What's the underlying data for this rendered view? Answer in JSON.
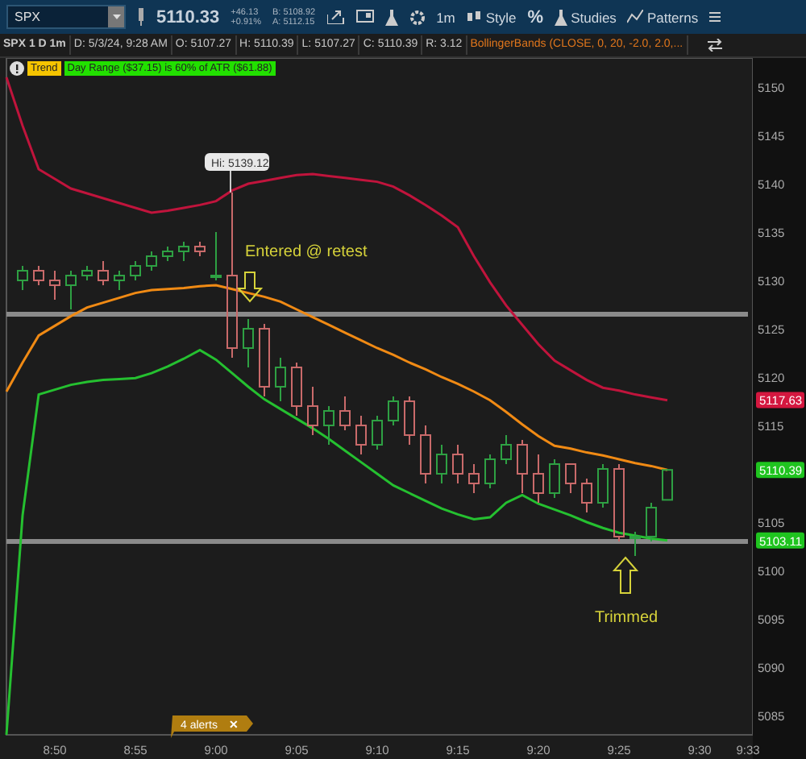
{
  "toolbar": {
    "symbol": "SPX",
    "last": "5110.33",
    "change": "+46.13",
    "change_pct": "+0.91%",
    "bid": "B: 5108.92",
    "ask": "A: 5112.15",
    "interval": "1m",
    "buttons": [
      {
        "kind": "style",
        "label": "Style"
      },
      {
        "kind": "percent",
        "label": "%"
      },
      {
        "kind": "studies",
        "label": "Studies"
      },
      {
        "kind": "patterns",
        "label": "Patterns"
      }
    ]
  },
  "info_bar": [
    "SPX 1 D 1m",
    "D: 5/3/24, 9:28 AM",
    "O: 5107.27",
    "H: 5110.39",
    "L: 5107.27",
    "C: 5110.39",
    "R: 3.12"
  ],
  "study": "BollingerBands (CLOSE, 0, 20, -2.0, 2.0,...",
  "alerts": [
    {
      "label": "Trend",
      "color": "#f5c400"
    },
    {
      "label": "Day Range ($37.15) is 60% of ATR ($61.88)",
      "color": "#22e000"
    }
  ],
  "chart_data": {
    "type": "candlestick",
    "x": [
      527,
      528,
      529,
      530,
      531,
      532,
      533,
      534,
      535,
      536,
      537,
      538,
      539,
      540,
      541,
      542,
      543,
      544,
      545,
      546,
      547,
      548,
      549,
      550,
      551,
      552,
      553,
      554,
      555,
      556,
      557,
      558,
      559,
      560,
      561,
      562,
      563,
      564,
      565,
      566,
      567,
      568,
      569,
      570,
      571,
      572,
      573
    ],
    "xlim": [
      527,
      573.3
    ],
    "ylim": [
      5083,
      5153
    ],
    "xticks": [
      {
        "value": 530,
        "label": "8:50"
      },
      {
        "value": 535,
        "label": "8:55"
      },
      {
        "value": 540,
        "label": "9:00"
      },
      {
        "value": 545,
        "label": "9:05"
      },
      {
        "value": 550,
        "label": "9:10"
      },
      {
        "value": 555,
        "label": "9:15"
      },
      {
        "value": 560,
        "label": "9:20"
      },
      {
        "value": 565,
        "label": "9:25"
      },
      {
        "value": 570,
        "label": "9:30"
      },
      {
        "value": 573,
        "label": "9:33"
      }
    ],
    "yticks": [
      5150,
      5145,
      5140,
      5135,
      5130,
      5125,
      5120,
      5115,
      5105,
      5100,
      5095,
      5090,
      5085
    ],
    "ohlc": [
      null,
      [
        5130,
        5131.5,
        5129,
        5131
      ],
      [
        5131,
        5131.5,
        5129.5,
        5130
      ],
      [
        5130,
        5131,
        5128,
        5129.5
      ],
      [
        5129.5,
        5131,
        5127,
        5130.5
      ],
      [
        5130.5,
        5131.5,
        5130,
        5131
      ],
      [
        5131,
        5132,
        5129.5,
        5130
      ],
      [
        5130,
        5131,
        5129,
        5130.5
      ],
      [
        5130.5,
        5132,
        5130,
        5131.5
      ],
      [
        5131.5,
        5133,
        5131,
        5132.5
      ],
      [
        5132.5,
        5133.5,
        5132,
        5133
      ],
      [
        5133,
        5134,
        5132,
        5133.5
      ],
      [
        5133.5,
        5134,
        5132.5,
        5133
      ],
      [
        5130.5,
        5135,
        5130,
        5130.5
      ],
      [
        5130.5,
        5139.1,
        5122,
        5123
      ],
      [
        5123,
        5126,
        5121,
        5125
      ],
      [
        5125,
        5125.5,
        5118,
        5119
      ],
      [
        5119,
        5122,
        5117.5,
        5121
      ],
      [
        5121,
        5121.5,
        5116,
        5117
      ],
      [
        5117,
        5119,
        5114,
        5115
      ],
      [
        5115,
        5117,
        5113,
        5116.5
      ],
      [
        5116.5,
        5118,
        5114.5,
        5115
      ],
      [
        5115,
        5116,
        5112,
        5113
      ],
      [
        5113,
        5116,
        5112.5,
        5115.5
      ],
      [
        5115.5,
        5118,
        5115,
        5117.5
      ],
      [
        5117.5,
        5118,
        5113,
        5114
      ],
      [
        5114,
        5115,
        5109,
        5110
      ],
      [
        5110,
        5113,
        5109,
        5112
      ],
      [
        5112,
        5113,
        5109,
        5110
      ],
      [
        5110,
        5111,
        5108,
        5109
      ],
      [
        5109,
        5112,
        5108.5,
        5111.5
      ],
      [
        5111.5,
        5114,
        5111,
        5113
      ],
      [
        5113,
        5113.5,
        5108,
        5110
      ],
      [
        5110,
        5112,
        5107,
        5108
      ],
      [
        5108,
        5111.5,
        5107.5,
        5111
      ],
      [
        5111,
        5111,
        5108,
        5109
      ],
      [
        5109,
        5109.5,
        5106,
        5107
      ],
      [
        5107,
        5111,
        5106.5,
        5110.5
      ],
      [
        5110.5,
        5111,
        5103,
        5103.5
      ],
      [
        5103.5,
        5104,
        5101.5,
        5103.5
      ],
      [
        5103.5,
        5107,
        5103,
        5106.5
      ],
      [
        5107.3,
        5110.4,
        5107.3,
        5110.4
      ],
      null,
      null,
      null,
      null,
      null
    ],
    "series": [
      {
        "type": "line",
        "color": "#c0143c",
        "values": [
          5151,
          5146,
          5141.5,
          5140.5,
          5139.5,
          5139,
          5138.5,
          5138,
          5137.5,
          5137,
          5137.2,
          5137.5,
          5137.8,
          5138.2,
          5139.3,
          5140,
          5140.3,
          5140.6,
          5140.9,
          5141,
          5140.8,
          5140.6,
          5140.4,
          5140.2,
          5139.7,
          5138.8,
          5137.8,
          5136.7,
          5135.5,
          5132.5,
          5129.8,
          5127.4,
          5125.4,
          5123.4,
          5121.7,
          5120.7,
          5119.7,
          5118.9,
          5118.6,
          5118.2,
          5117.9,
          5117.6,
          null,
          null,
          null,
          null,
          null
        ]
      },
      {
        "type": "line",
        "color": "#f08a14",
        "values": [
          5118.5,
          5121.5,
          5124.3,
          5125.3,
          5126.3,
          5127.2,
          5127.7,
          5128.2,
          5128.7,
          5129,
          5129.1,
          5129.2,
          5129.4,
          5129.5,
          5129.1,
          5128.7,
          5128.3,
          5127.8,
          5127,
          5126.2,
          5125.4,
          5124.6,
          5123.8,
          5123,
          5122.3,
          5121.5,
          5120.8,
          5120,
          5119.3,
          5118.5,
          5117.6,
          5116.4,
          5115.1,
          5113.9,
          5112.9,
          5112.6,
          5112.2,
          5111.9,
          5111.5,
          5111.1,
          5110.8,
          5110.4,
          null,
          null,
          null,
          null,
          null
        ]
      },
      {
        "type": "line",
        "color": "#25c030",
        "values": [
          5083,
          5105.7,
          5118.2,
          5118.7,
          5119.2,
          5119.5,
          5119.7,
          5119.8,
          5119.9,
          5120.4,
          5121.1,
          5121.9,
          5122.8,
          5121.8,
          5120.4,
          5119,
          5117.7,
          5116.7,
          5115.7,
          5114.7,
          5113.6,
          5112.4,
          5111.2,
          5110,
          5108.8,
          5108,
          5107.2,
          5106.4,
          5105.8,
          5105.3,
          5105.5,
          5107,
          5107.8,
          5106.9,
          5106.3,
          5105.7,
          5105,
          5104.4,
          5103.9,
          5103.6,
          5103.3,
          5103.1,
          null,
          null,
          null,
          null,
          null
        ]
      },
      {
        "type": "line",
        "color": "#8a8a8a",
        "values": [
          5126.5,
          5126.5,
          5126.5,
          5126.5,
          5126.5,
          5126.5,
          5126.5,
          5126.5,
          5126.5,
          5126.5,
          5126.5,
          5126.5,
          5126.5,
          5126.5,
          5126.5,
          5126.5,
          5126.5,
          5126.5,
          5126.5,
          5126.5,
          5126.5,
          5126.5,
          5126.5,
          5126.5,
          5126.5,
          5126.5,
          5126.5,
          5126.5,
          5126.5,
          5126.5,
          5126.5,
          5126.5,
          5126.5,
          5126.5,
          5126.5,
          5126.5,
          5126.5,
          5126.5,
          5126.5,
          5126.5,
          5126.5,
          5126.5,
          5126.5,
          5126.5,
          5126.5,
          5126.5,
          5126.5
        ]
      },
      {
        "type": "line",
        "color": "#8a8a8a",
        "values": [
          5103,
          5103,
          5103,
          5103,
          5103,
          5103,
          5103,
          5103,
          5103,
          5103,
          5103,
          5103,
          5103,
          5103,
          5103,
          5103,
          5103,
          5103,
          5103,
          5103,
          5103,
          5103,
          5103,
          5103,
          5103,
          5103,
          5103,
          5103,
          5103,
          5103,
          5103,
          5103,
          5103,
          5103,
          5103,
          5103,
          5103,
          5103,
          5103,
          5103,
          5103,
          5103,
          5103,
          5103,
          5103,
          5103,
          5103
        ]
      }
    ]
  },
  "price_tags": [
    {
      "value": "5117.63",
      "color": "#d4173f"
    },
    {
      "value": "5110.39",
      "color": "#1fc41f"
    },
    {
      "value": "5103.11",
      "color": "#1fc41f"
    }
  ],
  "high_label": "Hi: 5139.12",
  "annotations": [
    {
      "text": "Entered @ retest",
      "kind": "down"
    },
    {
      "text": "Trimmed",
      "kind": "up"
    }
  ],
  "alerts_badge": {
    "label": "4 alerts",
    "close": "✕"
  }
}
